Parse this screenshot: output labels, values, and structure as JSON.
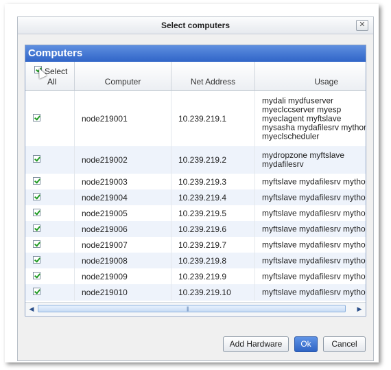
{
  "dialog": {
    "title": "Select computers",
    "close_glyph": "✕"
  },
  "panel": {
    "header": "Computers"
  },
  "table": {
    "columns": {
      "select_line1": "Select",
      "select_line2": "All",
      "computer": "Computer",
      "net_address": "Net Address",
      "usage": "Usage"
    },
    "rows": [
      {
        "checked": true,
        "computer": "node219001",
        "address": "10.239.219.1",
        "usage": "mydali mydfuserver myeclccserver myesp myeclagent myftslave mysasha mydafilesrv mythor myeclscheduler"
      },
      {
        "checked": true,
        "computer": "node219002",
        "address": "10.239.219.2",
        "usage": "mydropzone myftslave mydafilesrv"
      },
      {
        "checked": true,
        "computer": "node219003",
        "address": "10.239.219.3",
        "usage": "myftslave mydafilesrv mythor"
      },
      {
        "checked": true,
        "computer": "node219004",
        "address": "10.239.219.4",
        "usage": "myftslave mydafilesrv mythor"
      },
      {
        "checked": true,
        "computer": "node219005",
        "address": "10.239.219.5",
        "usage": "myftslave mydafilesrv mythor"
      },
      {
        "checked": true,
        "computer": "node219006",
        "address": "10.239.219.6",
        "usage": "myftslave mydafilesrv mythor"
      },
      {
        "checked": true,
        "computer": "node219007",
        "address": "10.239.219.7",
        "usage": "myftslave mydafilesrv mythor"
      },
      {
        "checked": true,
        "computer": "node219008",
        "address": "10.239.219.8",
        "usage": "myftslave mydafilesrv mythor"
      },
      {
        "checked": true,
        "computer": "node219009",
        "address": "10.239.219.9",
        "usage": "myftslave mydafilesrv mythor"
      },
      {
        "checked": true,
        "computer": "node219010",
        "address": "10.239.219.10",
        "usage": "myftslave mydafilesrv mythor"
      }
    ]
  },
  "scrollbar": {
    "left_glyph": "◀",
    "right_glyph": "▶",
    "grip_glyph": "|||"
  },
  "buttons": {
    "add_hardware": "Add Hardware",
    "ok": "Ok",
    "cancel": "Cancel"
  },
  "colors": {
    "panel_header": "#3065c8",
    "check_mark": "#1f9a22",
    "row_alt": "#eef3fb"
  },
  "icons": {
    "checkbox": "checkbox-checked-icon",
    "cursor": "mouse-pointer-icon",
    "close": "close-icon"
  }
}
